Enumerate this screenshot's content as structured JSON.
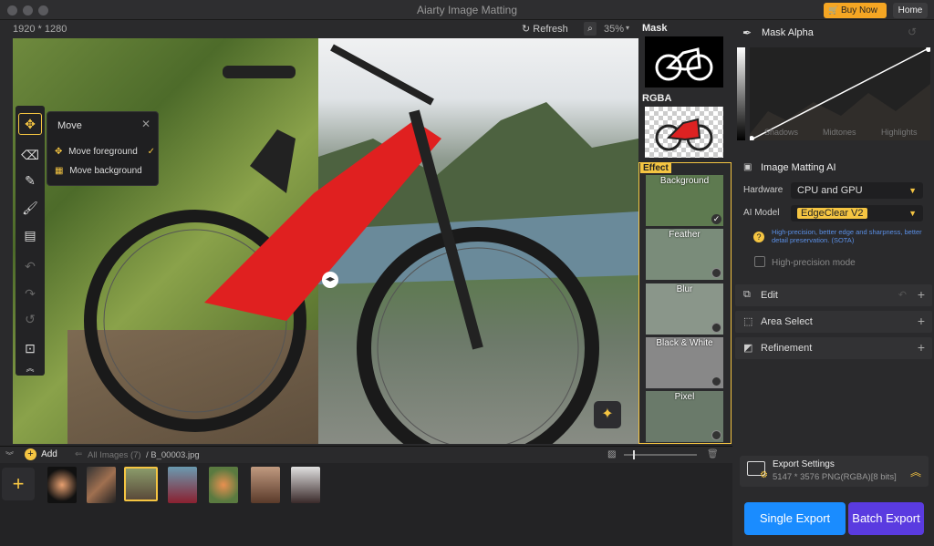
{
  "window": {
    "title": "Aiarty Image Matting",
    "buy_now": "Buy Now",
    "home": "Home"
  },
  "topbar": {
    "dimensions": "1920 * 1280",
    "refresh": "Refresh",
    "zoom": "35%"
  },
  "move_popup": {
    "title": "Move",
    "options": [
      "Move foreground",
      "Move background"
    ]
  },
  "side": {
    "mask": "Mask",
    "rgba": "RGBA",
    "effect": "Effect",
    "effects": [
      "Background",
      "Feather",
      "Blur",
      "Black & White",
      "Pixel"
    ]
  },
  "right": {
    "mask_alpha": "Mask Alpha",
    "curve_labels": [
      "Shadows",
      "Midtones",
      "Highlights"
    ],
    "image_matting": "Image Matting AI",
    "hardware_label": "Hardware",
    "hardware_value": "CPU and GPU",
    "model_label": "AI Model",
    "model_value": "EdgeClear  V2",
    "model_hint": "High-precision, better edge and sharpness, better detail preservation. (SOTA)",
    "high_precision": "High-precision mode",
    "edit": "Edit",
    "area_select": "Area Select",
    "refinement": "Refinement",
    "export_settings": "Export Settings",
    "export_detail": "5147 * 3576 PNG(RGBA)[8 bits]",
    "single_export": "Single Export",
    "batch_export": "Batch Export"
  },
  "bottom": {
    "add": "Add",
    "all_images": "All Images (7)",
    "filename": "/ B_00003.jpg"
  },
  "colors": {
    "accent": "#f5c542",
    "single": "#1a8cff",
    "batch": "#5a3be0",
    "buy": "#f5a623"
  }
}
